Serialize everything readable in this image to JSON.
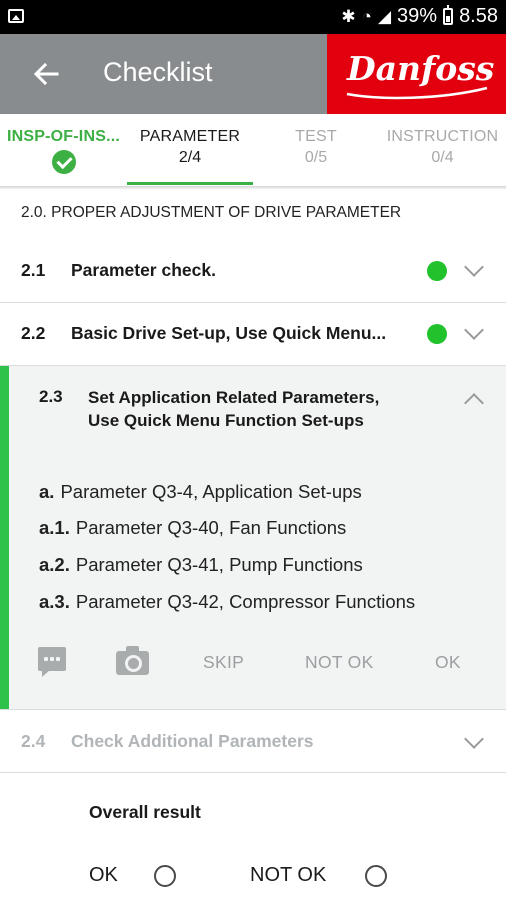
{
  "status_bar": {
    "battery": "39%",
    "time": "8.58"
  },
  "app_bar": {
    "title": "Checklist",
    "brand_logo": "Danfoss",
    "brand_color": "#e2000f",
    "bar_color": "#888c8e"
  },
  "tabs": [
    {
      "label": "INSP-OF-INS...",
      "state": "complete"
    },
    {
      "label": "PARAMETER",
      "count": "2/4",
      "state": "active"
    },
    {
      "label": "TEST",
      "count": "0/5",
      "state": "inactive"
    },
    {
      "label": "INSTRUCTION",
      "count": "0/4",
      "state": "inactive"
    }
  ],
  "section": {
    "heading": "2.0.  PROPER ADJUSTMENT OF DRIVE PARAMETER",
    "items": [
      {
        "num": "2.1",
        "title": "Parameter check.",
        "status": "complete",
        "expanded": false
      },
      {
        "num": "2.2",
        "title": "Basic Drive Set-up, Use Quick Menu...",
        "status": "complete",
        "expanded": false
      },
      {
        "num": "2.3",
        "title": "Set Application Related Parameters, Use Quick Menu Function Set-ups",
        "expanded": true,
        "params": [
          {
            "prefix": "a.",
            "text": "Parameter Q3-4, Application Set-ups"
          },
          {
            "prefix": "a.1.",
            "text": "Parameter Q3-40, Fan Functions"
          },
          {
            "prefix": "a.2.",
            "text": "Parameter Q3-41, Pump Functions"
          },
          {
            "prefix": "a.3.",
            "text": "Parameter Q3-42, Compressor Functions"
          }
        ],
        "actions": {
          "comment_icon": "comment-icon",
          "camera_icon": "camera-icon",
          "skip": "SKIP",
          "not_ok": "NOT OK",
          "ok": "OK"
        }
      },
      {
        "num": "2.4",
        "title": "Check Additional Parameters",
        "status": "disabled",
        "expanded": false
      }
    ]
  },
  "overall": {
    "label": "Overall result",
    "options": [
      "OK",
      "NOT OK"
    ]
  },
  "colors": {
    "accent_green": "#3cb043",
    "status_green": "#22c22d",
    "expanded_bar": "#2ec24a"
  }
}
